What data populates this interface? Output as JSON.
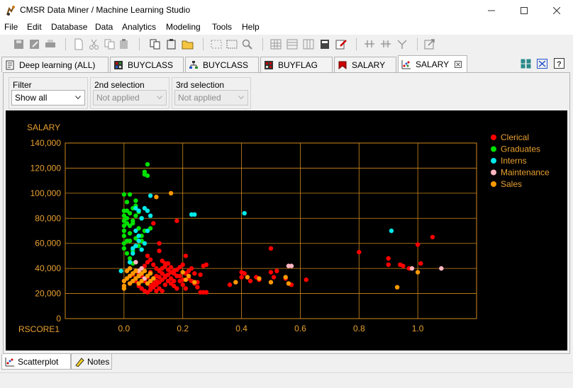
{
  "window": {
    "title": "CMSR Data Miner / Machine Learning Studio",
    "controls": [
      "minimize-icon",
      "maximize-icon",
      "close-icon"
    ]
  },
  "menu": [
    "File",
    "Edit",
    "Database",
    "Data",
    "Analytics",
    "Modeling",
    "Tools",
    "Help"
  ],
  "toolbar_icons": [
    "save-icon",
    "save-as-icon",
    "print-icon",
    "new-icon",
    "cut-icon",
    "copy-icon",
    "paste-icon",
    "copy-model-icon",
    "paste-model-icon",
    "open-folder-icon",
    "select-all-icon",
    "deselect-icon",
    "find-icon",
    "grid-view-icon",
    "table-icon",
    "columns-icon",
    "database-icon",
    "edit-icon",
    "split-h-icon",
    "split-v-icon",
    "merge-icon",
    "export-icon"
  ],
  "tabs": [
    {
      "label": "Deep learning (ALL)",
      "icon": "document-icon",
      "active": false
    },
    {
      "label": "BUYCLASS",
      "icon": "grid-chart-icon",
      "active": false
    },
    {
      "label": "BUYCLASS",
      "icon": "hierarchy-icon",
      "active": false
    },
    {
      "label": "BUYFLAG",
      "icon": "grid-chart-icon",
      "active": false
    },
    {
      "label": "SALARY",
      "icon": "bookmark-icon",
      "active": false
    },
    {
      "label": "SALARY",
      "icon": "scatter-icon",
      "active": true
    }
  ],
  "right_icons": [
    "tile-windows-icon",
    "fullscreen-icon",
    "help-icon"
  ],
  "filters": {
    "filter": {
      "label": "Filter",
      "value": "Show all",
      "enabled": true
    },
    "second": {
      "label": "2nd selection",
      "value": "Not applied",
      "enabled": false
    },
    "third": {
      "label": "3rd selection",
      "value": "Not applied",
      "enabled": false
    }
  },
  "bottom_tabs": [
    {
      "label": "Scatterplot",
      "icon": "scatter-icon",
      "active": true
    },
    {
      "label": "Notes",
      "icon": "notes-icon",
      "active": false
    }
  ],
  "chart_data": {
    "type": "scatter",
    "xlabel": "RSCORE1",
    "ylabel": "SALARY",
    "xlim": [
      -0.2,
      1.2
    ],
    "ylim": [
      0,
      140000
    ],
    "xticks": [
      "0.0",
      "0.2",
      "0.4",
      "0.6",
      "0.8",
      "1.0"
    ],
    "xtick_values": [
      0,
      0.2,
      0.4,
      0.6,
      0.8,
      1.0
    ],
    "yticks": [
      "0",
      "20,000",
      "40,000",
      "60,000",
      "80,000",
      "100,000",
      "120,000",
      "140,000"
    ],
    "ytick_values": [
      0,
      20000,
      40000,
      60000,
      80000,
      100000,
      120000,
      140000
    ],
    "grid": true,
    "legend_position": "top-right",
    "colors": {
      "axis": "#d08a1e",
      "background": "#000000",
      "text": "#e8a030"
    },
    "series": [
      {
        "name": "Clerical",
        "color": "#ff0000",
        "points": [
          [
            0.02,
            28000
          ],
          [
            0.03,
            35000
          ],
          [
            0.04,
            30000
          ],
          [
            0.05,
            26000
          ],
          [
            0.06,
            24000
          ],
          [
            0.07,
            22000
          ],
          [
            0.08,
            21000
          ],
          [
            0.09,
            23000
          ],
          [
            0.1,
            25000
          ],
          [
            0.11,
            27000
          ],
          [
            0.12,
            29000
          ],
          [
            0.13,
            31000
          ],
          [
            0.14,
            33000
          ],
          [
            0.15,
            35000
          ],
          [
            0.16,
            37000
          ],
          [
            0.17,
            38000
          ],
          [
            0.18,
            39000
          ],
          [
            0.19,
            41000
          ],
          [
            0.2,
            43000
          ],
          [
            0.21,
            36000
          ],
          [
            0.22,
            32000
          ],
          [
            0.23,
            30000
          ],
          [
            0.24,
            28000
          ],
          [
            0.25,
            29000
          ],
          [
            0.26,
            35000
          ],
          [
            0.27,
            42000
          ],
          [
            0.28,
            43000
          ],
          [
            0.05,
            36000
          ],
          [
            0.06,
            40000
          ],
          [
            0.08,
            45000
          ],
          [
            0.09,
            47000
          ],
          [
            0.1,
            43000
          ],
          [
            0.11,
            40000
          ],
          [
            0.12,
            38000
          ],
          [
            0.13,
            36000
          ],
          [
            0.14,
            34000
          ],
          [
            0.15,
            30000
          ],
          [
            0.16,
            28000
          ],
          [
            0.17,
            26000
          ],
          [
            0.18,
            24000
          ],
          [
            0.1,
            32000
          ],
          [
            0.11,
            34000
          ],
          [
            0.12,
            24000
          ],
          [
            0.13,
            22000
          ],
          [
            0.14,
            27000
          ],
          [
            0.07,
            30000
          ],
          [
            0.08,
            33000
          ],
          [
            0.09,
            37000
          ],
          [
            0.1,
            28000
          ],
          [
            0.11,
            22000
          ],
          [
            0.12,
            33000
          ],
          [
            0.13,
            40000
          ],
          [
            0.14,
            42000
          ],
          [
            0.15,
            44000
          ],
          [
            0.16,
            32000
          ],
          [
            0.17,
            30000
          ],
          [
            0.18,
            34000
          ],
          [
            0.19,
            30000
          ],
          [
            0.2,
            27000
          ],
          [
            0.21,
            24000
          ],
          [
            0.22,
            38000
          ],
          [
            0.23,
            40000
          ],
          [
            0.24,
            36000
          ],
          [
            0.25,
            25000
          ],
          [
            0.26,
            21000
          ],
          [
            0.27,
            21000
          ],
          [
            0.28,
            21000
          ],
          [
            0.12,
            54000
          ],
          [
            0.14,
            44000
          ],
          [
            0.08,
            50000
          ],
          [
            0.1,
            76000
          ],
          [
            0.12,
            60000
          ],
          [
            0.18,
            78000
          ],
          [
            0.13,
            46000
          ],
          [
            0.21,
            50000
          ],
          [
            0.15,
            39000
          ],
          [
            0.16,
            41000
          ],
          [
            0.06,
            34000
          ],
          [
            0.07,
            42000
          ],
          [
            0.09,
            26000
          ],
          [
            0.11,
            30000
          ],
          [
            0.17,
            36000
          ],
          [
            0.19,
            34000
          ],
          [
            0.2,
            31000
          ],
          [
            0.36,
            27000
          ],
          [
            0.38,
            29000
          ],
          [
            0.4,
            37000
          ],
          [
            0.41,
            36000
          ],
          [
            0.45,
            33000
          ],
          [
            0.46,
            31000
          ],
          [
            0.5,
            37000
          ],
          [
            0.5,
            56000
          ],
          [
            0.51,
            33000
          ],
          [
            0.52,
            38000
          ],
          [
            0.55,
            32000
          ],
          [
            0.56,
            28000
          ],
          [
            0.57,
            27000
          ],
          [
            0.62,
            31000
          ],
          [
            0.8,
            53000
          ],
          [
            0.9,
            48000
          ],
          [
            0.9,
            43000
          ],
          [
            0.94,
            43000
          ],
          [
            0.95,
            42000
          ],
          [
            1.0,
            59000
          ],
          [
            1.01,
            44000
          ],
          [
            1.05,
            65000
          ],
          [
            0.97,
            40000
          ],
          [
            0.4,
            33000
          ],
          [
            0.43,
            30000
          ]
        ]
      },
      {
        "name": "Graduates",
        "color": "#00e000",
        "points": [
          [
            0.0,
            99000
          ],
          [
            0.01,
            93000
          ],
          [
            0.02,
            99000
          ],
          [
            0.0,
            86000
          ],
          [
            0.0,
            82000
          ],
          [
            0.01,
            80000
          ],
          [
            0.02,
            84000
          ],
          [
            0.03,
            78000
          ],
          [
            0.04,
            90000
          ],
          [
            0.05,
            72000
          ],
          [
            0.06,
            66000
          ],
          [
            0.07,
            115000
          ],
          [
            0.08,
            114000
          ],
          [
            0.08,
            123000
          ],
          [
            0.07,
            117000
          ],
          [
            0.0,
            70000
          ],
          [
            0.0,
            66000
          ],
          [
            0.0,
            60000
          ],
          [
            0.0,
            56000
          ],
          [
            0.01,
            62000
          ],
          [
            0.02,
            68000
          ],
          [
            0.02,
            74000
          ],
          [
            0.03,
            76000
          ],
          [
            0.04,
            82000
          ],
          [
            0.05,
            85000
          ],
          [
            0.06,
            80000
          ],
          [
            0.07,
            70000
          ],
          [
            0.01,
            76000
          ],
          [
            0.0,
            74000
          ],
          [
            0.0,
            78000
          ],
          [
            0.01,
            86000
          ],
          [
            0.03,
            88000
          ],
          [
            0.04,
            94000
          ],
          [
            0.02,
            62000
          ],
          [
            0.03,
            54000
          ],
          [
            0.04,
            64000
          ],
          [
            0.05,
            58000
          ],
          [
            0.06,
            62000
          ],
          [
            0.01,
            52000
          ],
          [
            0.02,
            48000
          ],
          [
            0.03,
            44000
          ],
          [
            0.09,
            72000
          ]
        ]
      },
      {
        "name": "Interns",
        "color": "#00e8e8",
        "points": [
          [
            -0.01,
            38000
          ],
          [
            0.02,
            45000
          ],
          [
            0.03,
            52000
          ],
          [
            0.04,
            58000
          ],
          [
            0.05,
            62000
          ],
          [
            0.06,
            55000
          ],
          [
            0.07,
            60000
          ],
          [
            0.08,
            70000
          ],
          [
            0.07,
            88000
          ],
          [
            0.08,
            86000
          ],
          [
            0.09,
            82000
          ],
          [
            0.09,
            98000
          ],
          [
            0.06,
            80000
          ],
          [
            0.05,
            86000
          ],
          [
            0.04,
            88000
          ],
          [
            0.04,
            70000
          ],
          [
            0.05,
            66000
          ],
          [
            0.03,
            56000
          ],
          [
            0.23,
            83000
          ],
          [
            0.24,
            83000
          ],
          [
            0.41,
            84000
          ],
          [
            0.91,
            70000
          ]
        ]
      },
      {
        "name": "Maintenance",
        "color": "#ffb6c1",
        "points": [
          [
            0.04,
            45000
          ],
          [
            0.05,
            38000
          ],
          [
            0.06,
            40000
          ],
          [
            0.07,
            32000
          ],
          [
            0.56,
            42000
          ],
          [
            0.57,
            42000
          ],
          [
            0.98,
            40000
          ],
          [
            1.08,
            40000
          ]
        ]
      },
      {
        "name": "Sales",
        "color": "#ff9900",
        "points": [
          [
            0.0,
            26000
          ],
          [
            0.0,
            30000
          ],
          [
            0.0,
            24000
          ],
          [
            0.01,
            32000
          ],
          [
            0.02,
            28000
          ],
          [
            0.02,
            34000
          ],
          [
            0.03,
            30000
          ],
          [
            0.03,
            36000
          ],
          [
            0.04,
            32000
          ],
          [
            0.05,
            28000
          ],
          [
            0.05,
            34000
          ],
          [
            0.06,
            30000
          ],
          [
            0.06,
            36000
          ],
          [
            0.07,
            38000
          ],
          [
            0.08,
            34000
          ],
          [
            0.08,
            28000
          ],
          [
            0.09,
            30000
          ],
          [
            0.09,
            36000
          ],
          [
            0.1,
            32000
          ],
          [
            0.04,
            38000
          ],
          [
            0.02,
            40000
          ],
          [
            0.01,
            38000
          ],
          [
            0.16,
            100000
          ],
          [
            0.11,
            97000
          ],
          [
            0.2,
            37000
          ],
          [
            0.21,
            31000
          ],
          [
            0.22,
            34000
          ],
          [
            0.24,
            29000
          ],
          [
            0.38,
            29000
          ],
          [
            0.42,
            33000
          ],
          [
            0.46,
            32000
          ],
          [
            0.5,
            29000
          ],
          [
            0.55,
            33000
          ],
          [
            0.56,
            28000
          ],
          [
            0.93,
            25000
          ],
          [
            1.0,
            37000
          ]
        ]
      }
    ]
  }
}
